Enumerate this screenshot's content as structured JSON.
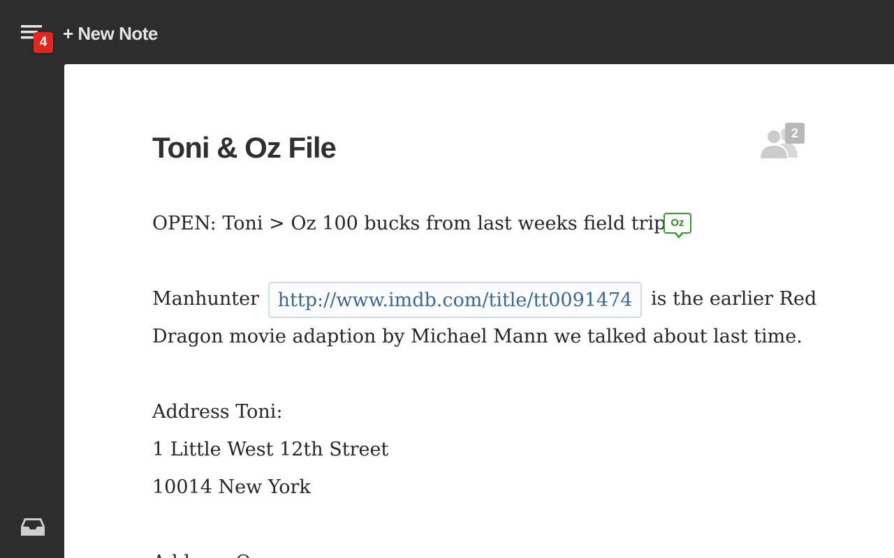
{
  "topbar": {
    "menu_badge_count": "4",
    "new_note_label": "+ New Note"
  },
  "note": {
    "title": "Toni & Oz File",
    "collaborator_count": "2",
    "mention_tag": "Oz",
    "line1_text": "OPEN: Toni > Oz 100 bucks from last weeks field trip.",
    "line2_prefix": "Manhunter ",
    "link_url": "http://www.imdb.com/title/tt0091474",
    "line2_suffix": " is the earlier Red",
    "line3_text": "Dragon movie adaption by Michael Mann we talked about last time.",
    "address_toni_label": "Address Toni:",
    "address_toni_street": "1 Little West 12th Street",
    "address_toni_city": "10014 New York",
    "address_oz_partial": "Address Oz:"
  },
  "icons": {
    "menu": "menu-list-icon",
    "collaborators": "people-icon",
    "inbox": "inbox-tray-icon"
  },
  "colors": {
    "sidebar_bg": "#2d2d2d",
    "badge_red": "#e0281e",
    "mention_green": "#3a9a2f",
    "link_blue": "#3d6792"
  }
}
